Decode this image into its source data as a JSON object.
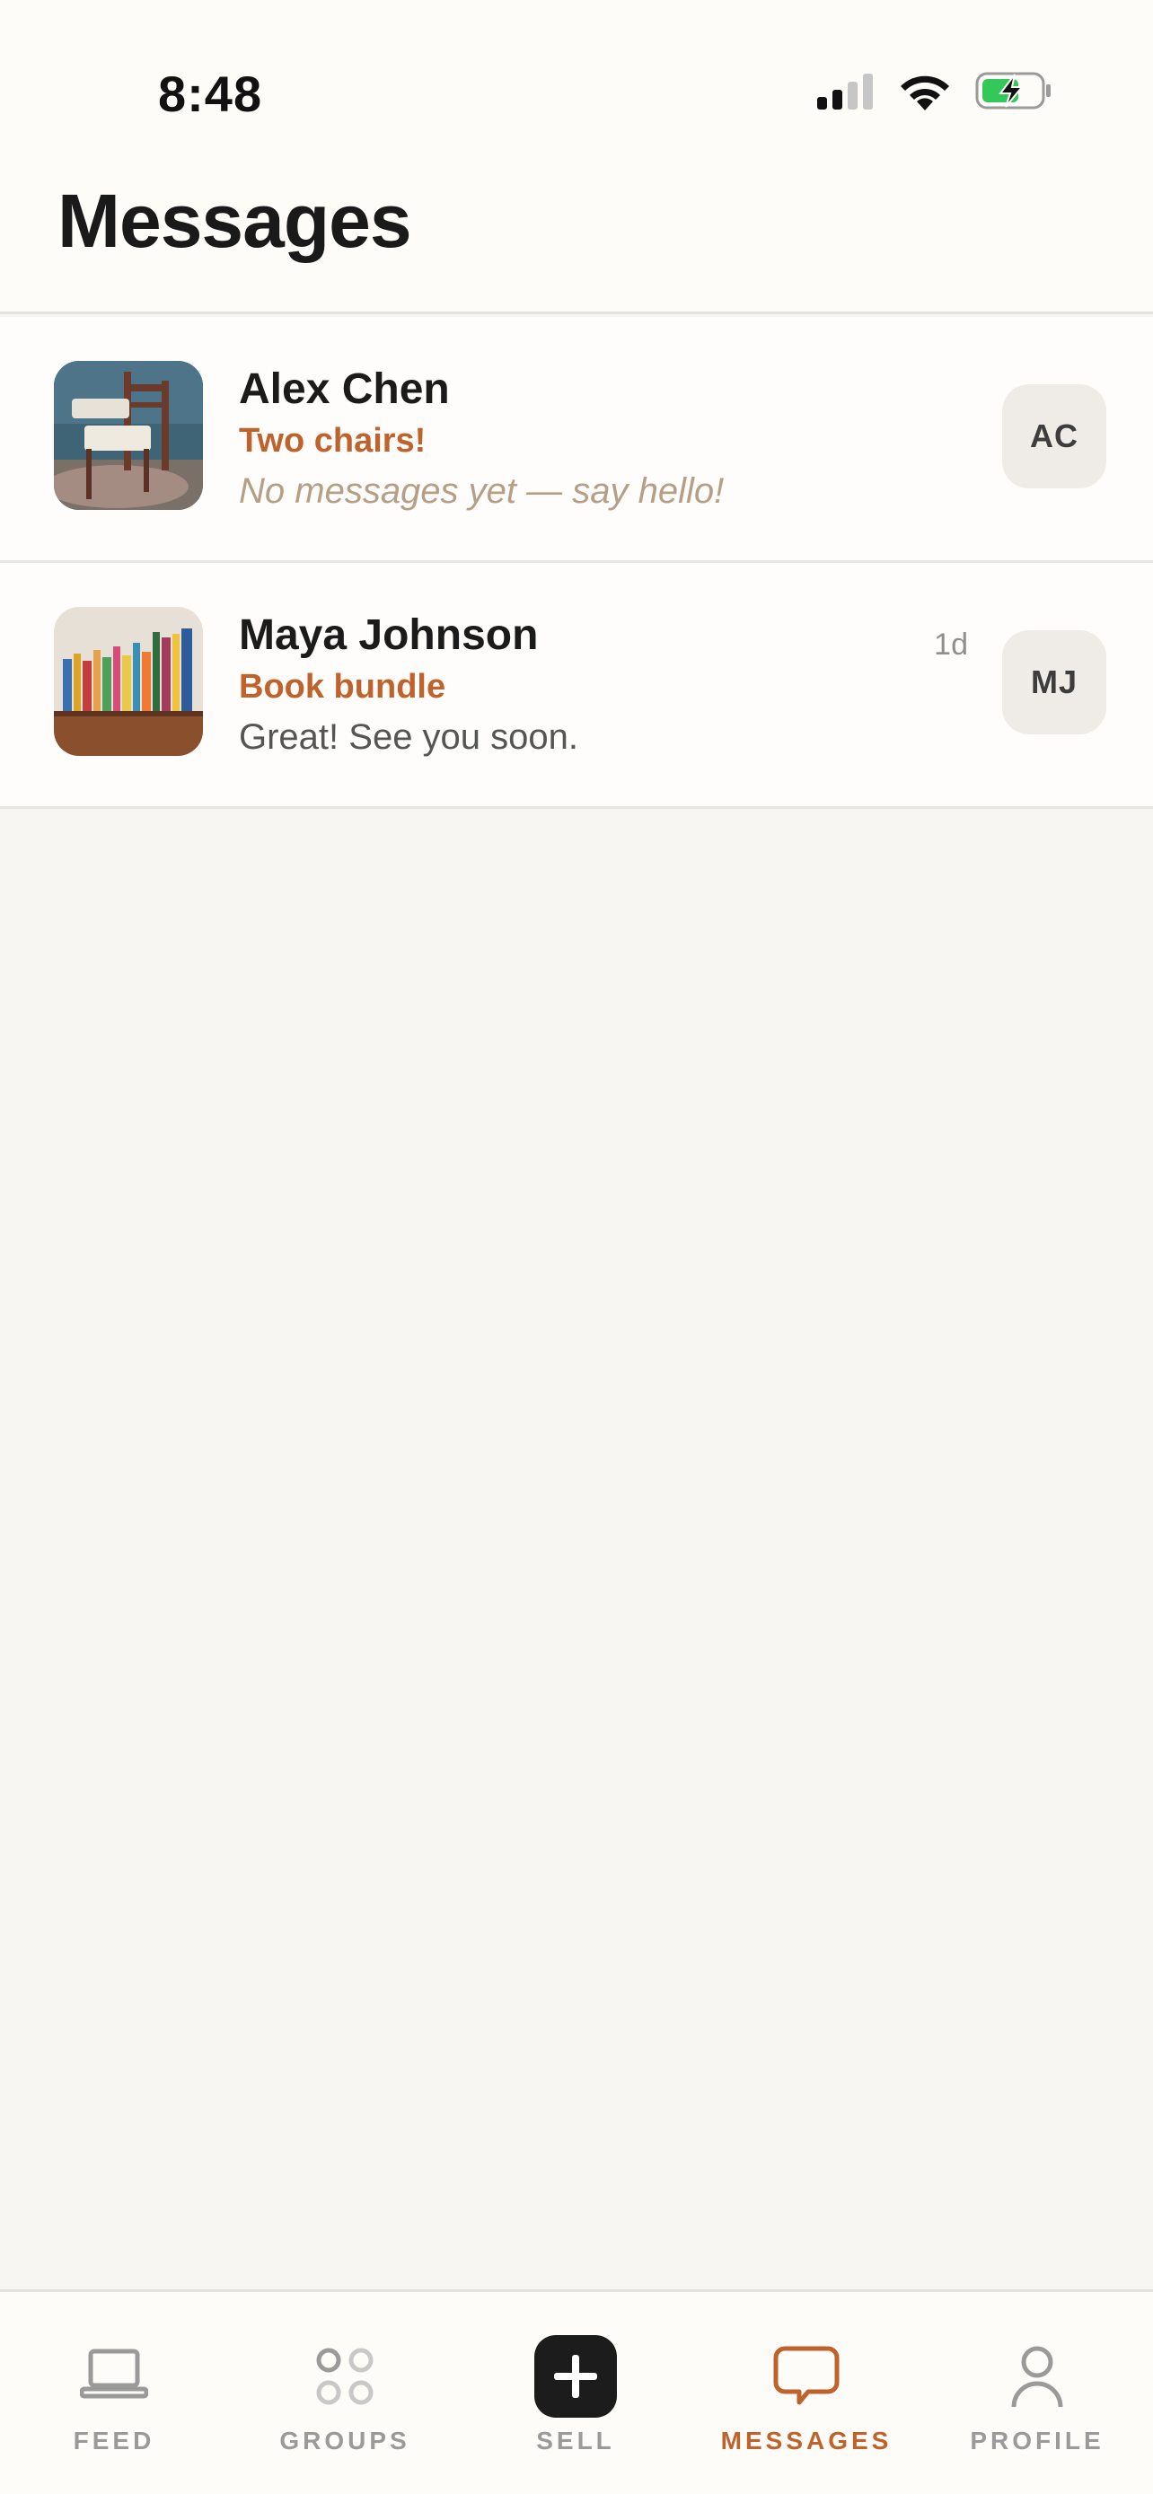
{
  "status_bar": {
    "time": "8:48",
    "icons": [
      "cellular-signal-icon",
      "wifi-icon",
      "battery-charging-icon"
    ],
    "battery_color": "#34c759"
  },
  "header": {
    "title": "Messages"
  },
  "conversations": [
    {
      "name": "Alex Chen",
      "listing": "Two chairs!",
      "preview": "No messages yet — say hello!",
      "time": "",
      "avatar_initials": "AC",
      "thumbnail": "chairs-photo"
    },
    {
      "name": "Maya Johnson",
      "listing": "Book bundle",
      "preview": "Great! See you soon.",
      "time": "1d",
      "avatar_initials": "MJ",
      "thumbnail": "books-photo"
    }
  ],
  "tab_bar": {
    "active": "MESSAGES",
    "tabs": [
      {
        "label": "FEED",
        "icon": "laptop-icon"
      },
      {
        "label": "GROUPS",
        "icon": "groups-dots-icon"
      },
      {
        "label": "SELL",
        "icon": "plus-icon"
      },
      {
        "label": "MESSAGES",
        "icon": "chat-bubble-icon"
      },
      {
        "label": "PROFILE",
        "icon": "person-icon"
      }
    ]
  },
  "colors": {
    "accent": "#c0622b",
    "background": "#f7f6f3",
    "surface": "#fdfcf9"
  }
}
